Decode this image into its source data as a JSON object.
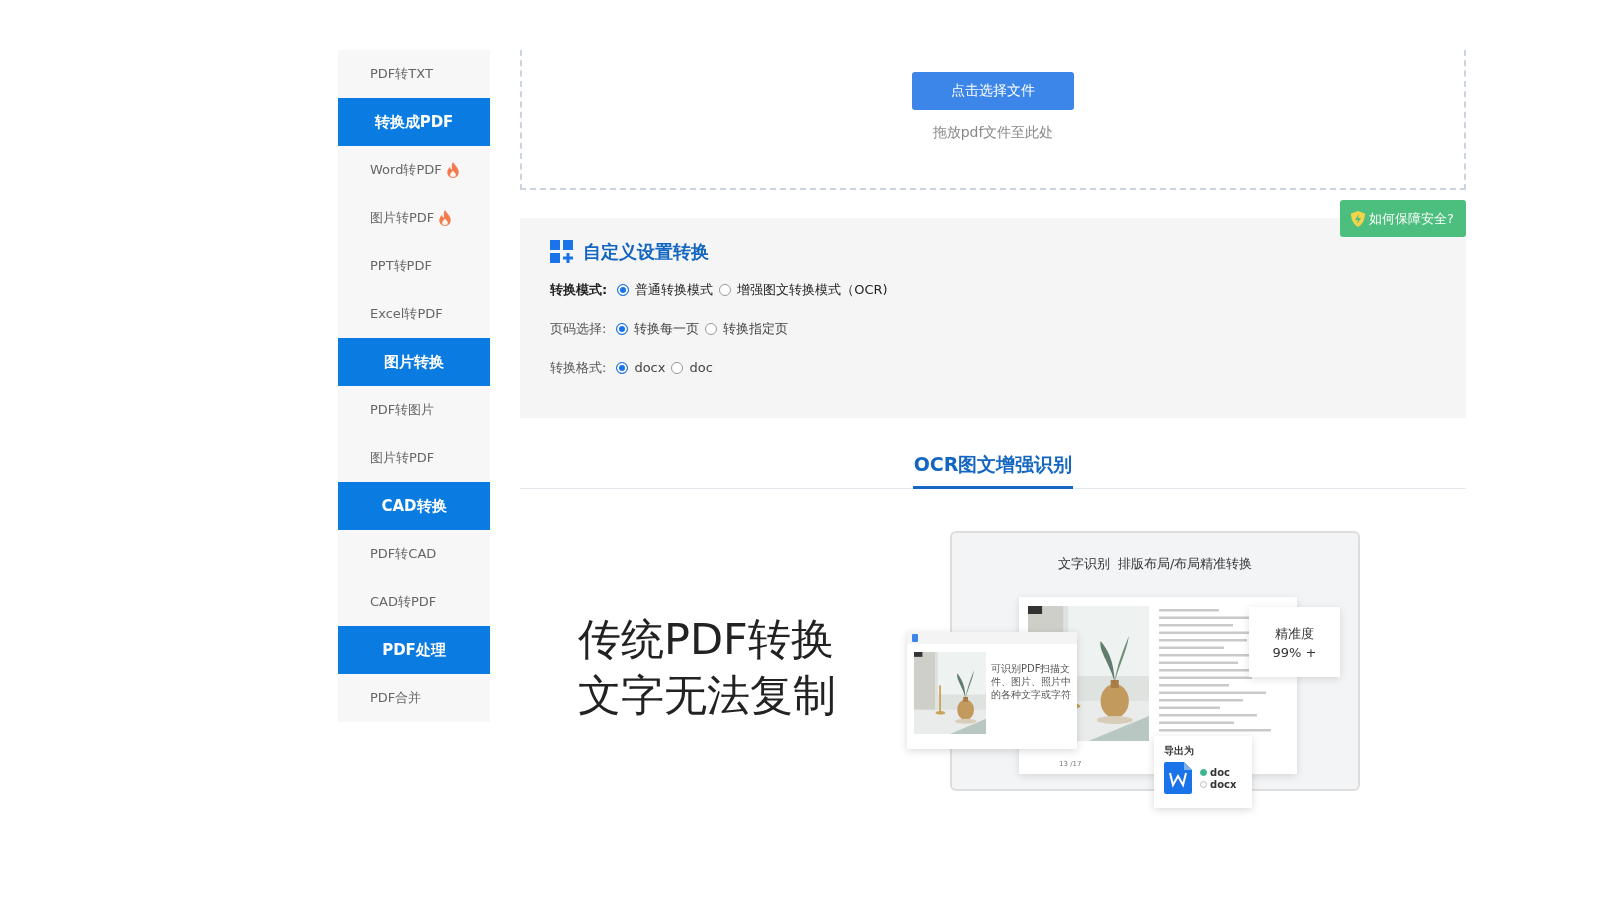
{
  "sidebar": {
    "items": [
      {
        "kind": "item",
        "label": "PDF转TXT",
        "hot": false
      },
      {
        "kind": "header",
        "label": "转换成PDF"
      },
      {
        "kind": "item",
        "label": "Word转PDF",
        "hot": true
      },
      {
        "kind": "item",
        "label": "图片转PDF",
        "hot": true
      },
      {
        "kind": "item",
        "label": "PPT转PDF",
        "hot": false
      },
      {
        "kind": "item",
        "label": "Excel转PDF",
        "hot": false
      },
      {
        "kind": "header",
        "label": "图片转换"
      },
      {
        "kind": "item",
        "label": "PDF转图片",
        "hot": false
      },
      {
        "kind": "item",
        "label": "图片转PDF",
        "hot": false
      },
      {
        "kind": "header",
        "label": "CAD转换"
      },
      {
        "kind": "item",
        "label": "PDF转CAD",
        "hot": false
      },
      {
        "kind": "item",
        "label": "CAD转PDF",
        "hot": false
      },
      {
        "kind": "header",
        "label": "PDF处理"
      },
      {
        "kind": "item",
        "label": "PDF合并",
        "hot": false
      }
    ]
  },
  "upload": {
    "button": "点击选择文件",
    "hint": "拖放pdf文件至此处"
  },
  "security_badge": "如何保障安全?",
  "settings": {
    "title": "自定义设置转换",
    "rows": [
      {
        "label": "转换模式:",
        "emphasized": true,
        "options": [
          {
            "label": "普通转换模式",
            "selected": true
          },
          {
            "label": "增强图文转换模式（OCR)",
            "selected": false
          }
        ]
      },
      {
        "label": "页码选择:",
        "emphasized": false,
        "options": [
          {
            "label": "转换每一页",
            "selected": true
          },
          {
            "label": "转换指定页",
            "selected": false
          }
        ]
      },
      {
        "label": "转换格式:",
        "emphasized": false,
        "options": [
          {
            "label": "docx",
            "selected": true
          },
          {
            "label": "doc",
            "selected": false
          }
        ]
      }
    ]
  },
  "tabs": [
    {
      "label": "OCR图文增强识别",
      "selected": true
    }
  ],
  "promo": {
    "lines": [
      "传统PDF转换",
      "文字无法复制"
    ]
  },
  "illustration": {
    "title": "文字识别  排版布局/布局精准转换",
    "accuracy_label": "精准度",
    "accuracy_value": "99% +",
    "caption": "可识别PDF扫描文件、图片、照片中的各种文字或字符",
    "pager": "13 /17",
    "export": {
      "title": "导出为",
      "options": [
        {
          "label": "doc",
          "selected": true
        },
        {
          "label": "docx",
          "selected": false
        }
      ]
    }
  }
}
